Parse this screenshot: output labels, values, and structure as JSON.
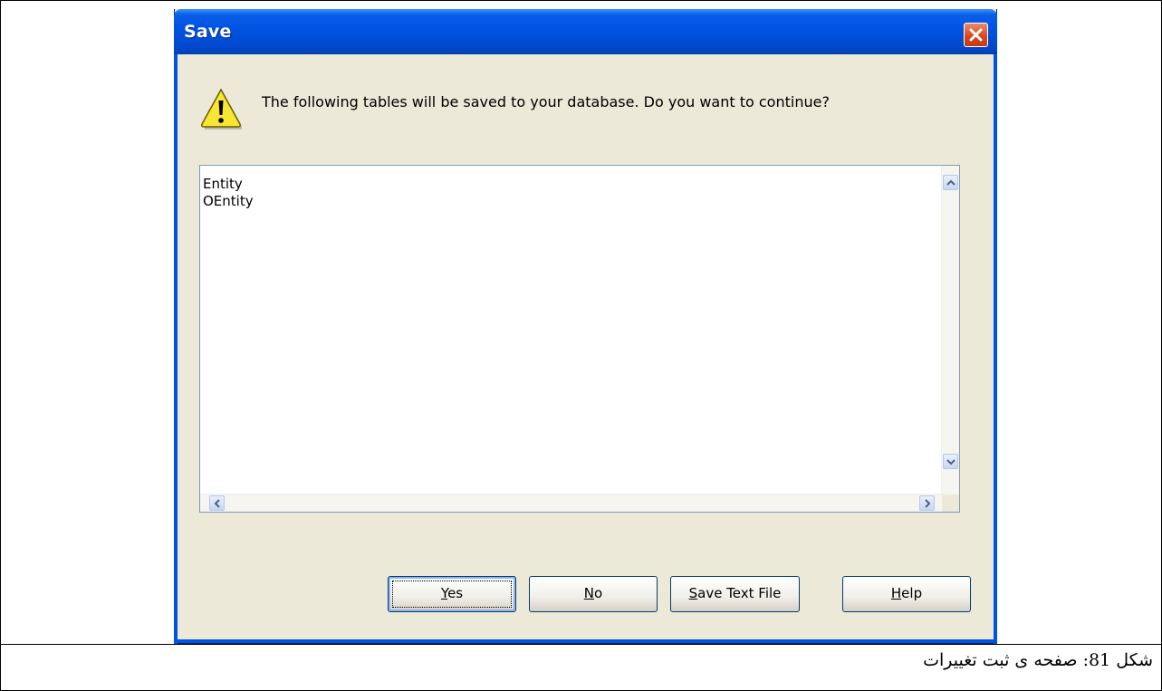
{
  "dialog": {
    "title": "Save",
    "message": "The following tables will be saved to your database. Do you want to continue?",
    "tables": [
      "Entity",
      "OEntity"
    ],
    "buttons": {
      "yes": {
        "mnemonic": "Y",
        "rest": "es"
      },
      "no": {
        "mnemonic": "N",
        "rest": "o"
      },
      "save_text_file": {
        "mnemonic": "S",
        "rest": "ave Text File"
      },
      "help": {
        "mnemonic": "H",
        "rest": "elp"
      }
    },
    "icons": {
      "warning": "warning-icon",
      "close": "close-icon"
    }
  },
  "caption": "شکل 81: صفحه ی ثبت تغییرات",
  "colors": {
    "titlebar": "#0054e3",
    "close": "#d6451f",
    "dialog_bg": "#ece9d8"
  }
}
